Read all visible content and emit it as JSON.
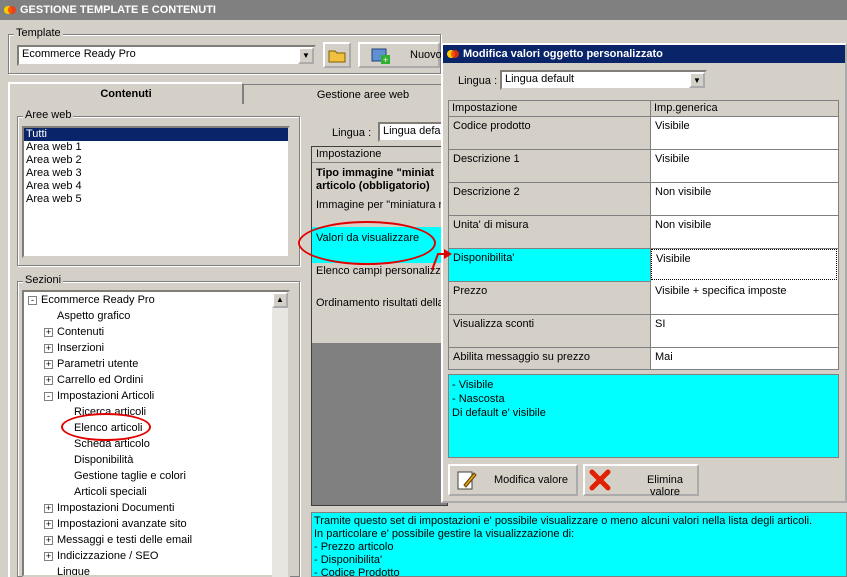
{
  "window": {
    "title": "GESTIONE TEMPLATE E CONTENUTI"
  },
  "template": {
    "label": "Template",
    "selected": "Ecommerce Ready Pro",
    "new_button": "Nuovo"
  },
  "tabs": [
    {
      "label": "Contenuti",
      "active": true
    },
    {
      "label": "Gestione aree web",
      "active": false
    }
  ],
  "aree_web": {
    "label": "Aree web",
    "items": [
      "Tutti",
      "Area web 1",
      "Area web 2",
      "Area web 3",
      "Area web 4",
      "Area web 5"
    ],
    "selected_index": 0
  },
  "sezioni": {
    "label": "Sezioni",
    "items": [
      {
        "label": "Ecommerce Ready Pro",
        "level": 0,
        "expander": "-"
      },
      {
        "label": "Aspetto grafico",
        "level": 1,
        "expander": ""
      },
      {
        "label": "Contenuti",
        "level": 1,
        "expander": "+"
      },
      {
        "label": "Inserzioni",
        "level": 1,
        "expander": "+"
      },
      {
        "label": "Parametri utente",
        "level": 1,
        "expander": "+"
      },
      {
        "label": "Carrello ed Ordini",
        "level": 1,
        "expander": "+"
      },
      {
        "label": "Impostazioni Articoli",
        "level": 1,
        "expander": "-"
      },
      {
        "label": "Ricerca articoli",
        "level": 2,
        "expander": ""
      },
      {
        "label": "Elenco articoli",
        "level": 2,
        "expander": ""
      },
      {
        "label": "Scheda articolo",
        "level": 2,
        "expander": ""
      },
      {
        "label": "Disponibilità",
        "level": 2,
        "expander": ""
      },
      {
        "label": "Gestione taglie e colori",
        "level": 2,
        "expander": ""
      },
      {
        "label": "Articoli speciali",
        "level": 2,
        "expander": ""
      },
      {
        "label": "Impostazioni Documenti",
        "level": 1,
        "expander": "+"
      },
      {
        "label": "Impostazioni avanzate sito",
        "level": 1,
        "expander": "+"
      },
      {
        "label": "Messaggi e testi delle email",
        "level": 1,
        "expander": "+"
      },
      {
        "label": "Indicizzazione / SEO",
        "level": 1,
        "expander": "+"
      },
      {
        "label": "Lingue",
        "level": 1,
        "expander": ""
      }
    ]
  },
  "main": {
    "lingua_label": "Lingua :",
    "lingua_value": "Lingua defa",
    "header": "Impostazione",
    "rows": [
      "Tipo immagine \"miniat articolo (obbligatorio)",
      "Immagine per \"miniatura n",
      "Valori da visualizzare",
      "Elenco campi personalizza",
      "Ordinamento risultati della"
    ],
    "info_lines": [
      "Tramite questo set di impostazioni e' possibile visualizzare o meno alcuni valori nella lista degli articoli.",
      "In particolare e' possibile gestire la visualizzazione di:",
      "- Prezzo articolo",
      "- Disponibilita'",
      "- Codice Prodotto"
    ]
  },
  "dialog": {
    "title": "Modifica valori oggetto personalizzato",
    "lingua_label": "Lingua :",
    "lingua_value": "Lingua default",
    "col_impostazione": "Impostazione",
    "col_valore": "Imp.generica",
    "rows": [
      {
        "name": "Codice prodotto",
        "value": "Visibile"
      },
      {
        "name": "Descrizione 1",
        "value": "Visibile"
      },
      {
        "name": "Descrizione 2",
        "value": "Non visibile"
      },
      {
        "name": "Unita' di misura",
        "value": "Non visibile"
      },
      {
        "name": "Disponibilita'",
        "value": "Visibile"
      },
      {
        "name": "Prezzo",
        "value": "Visibile + specifica imposte"
      },
      {
        "name": "Visualizza sconti",
        "value": "SI"
      },
      {
        "name": "Abilita messaggio su prezzo",
        "value": "Mai"
      }
    ],
    "selected_row": 4,
    "help_lines": [
      "- Visibile",
      "- Nascosta",
      "Di default e' visibile"
    ],
    "modify_button": "Modifica valore",
    "delete_button": "Elimina valore"
  },
  "colors": {
    "highlight": "#00ffff",
    "selection": "#0a246a",
    "annotation": "#e00000"
  }
}
